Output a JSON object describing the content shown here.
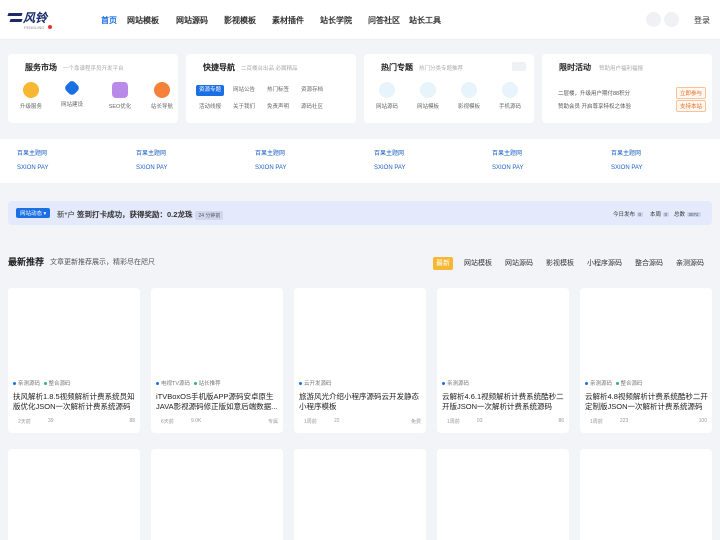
{
  "header": {
    "logo_text": "风铃",
    "logo_sub": "FENGLING",
    "nav": [
      "首页",
      "网站模板",
      "网站源码",
      "影视模板",
      "素材插件",
      "站长学院",
      "问答社区",
      "站长工具"
    ],
    "login": "登录"
  },
  "cards": {
    "service": {
      "title": "服务市场",
      "sub": "一个靠谱程序员开发平台",
      "items": [
        "升级服务",
        "网站建设",
        "SEO优化",
        "站长导航"
      ]
    },
    "quick": {
      "title": "快捷导航",
      "sub": "二百楼台出品 必属精品",
      "tags": [
        "资源专题",
        "网站公告",
        "热门标签",
        "资源存档",
        "活动线报",
        "关于我们",
        "免责声明",
        "源码社区"
      ]
    },
    "hot": {
      "title": "热门专题",
      "sub": "热门分类专题推荐",
      "items": [
        "网站源码",
        "网站模板",
        "影视模板",
        "手机源码"
      ]
    },
    "activity": {
      "title": "限时活动",
      "sub": "赞助用户福利福报",
      "rows": [
        {
          "text": "二层楼，升级用户期付88积分",
          "btn": "立即参与"
        },
        {
          "text": "赞助会员 开启尊享特权之体验",
          "btn": "支持本站"
        }
      ]
    }
  },
  "links": [
    {
      "name": "百果主题网",
      "sub": "SXION PAY"
    },
    {
      "name": "百果主题网",
      "sub": "SXION PAY"
    },
    {
      "name": "百果主题网",
      "sub": "SXION PAY"
    },
    {
      "name": "百果主题网",
      "sub": "SXION PAY"
    },
    {
      "name": "百果主题网",
      "sub": "SXION PAY"
    },
    {
      "name": "百果主题网",
      "sub": "SXION PAY"
    }
  ],
  "notice": {
    "tag": "网站动态 ▾",
    "user": "新*户",
    "text": "签到打卡成功，获得奖励：0.2龙珠",
    "time": "24 分钟前",
    "stats": [
      {
        "label": "今日发布",
        "value": "0"
      },
      {
        "label": "本周",
        "value": "0"
      },
      {
        "label": "总数",
        "value": "3072"
      }
    ]
  },
  "section": {
    "title": "最新推荐",
    "sub": "文章更新推荐展示，精彩尽在咫尺",
    "tabs": [
      "最新",
      "网站模板",
      "网站源码",
      "影视模板",
      "小程序源码",
      "整合源码",
      "亲测源码"
    ]
  },
  "posts": [
    {
      "tags": [
        "亲测源码",
        "整合源码"
      ],
      "title": "扶风解析1.8.5视频解析计费系统员知版优化JSON一次解析计费系统源码",
      "time": "2天前",
      "views": "39",
      "extra": "88"
    },
    {
      "tags": [
        "电视TV源码",
        "站长推荐"
      ],
      "title": "iTVBoxOS手机版APP源码安卓原生JAVA影视源码修正版如意后端数据...",
      "time": "6天前",
      "views": "9.0K",
      "extra": "专属"
    },
    {
      "tags": [
        "云开发源码"
      ],
      "title": "旅游风光介绍小程序源码云开发静态小程序模板",
      "time": "1周前",
      "views": "22",
      "extra": "免费"
    },
    {
      "tags": [
        "亲测源码"
      ],
      "title": "云解析4.6.1视频解析计费系统酷秒二开版JSON一次解析计费系统源码",
      "time": "1周前",
      "views": "93",
      "extra": "86"
    },
    {
      "tags": [
        "亲测源码",
        "整合源码"
      ],
      "title": "云解析4.8视频解析计费系统酷秒二开定制版JSON一次解析计费系统源码",
      "time": "1周前",
      "views": "223",
      "extra": "100"
    }
  ],
  "colors": {
    "accent": "#1b6fe4",
    "warn": "#f7b733"
  }
}
